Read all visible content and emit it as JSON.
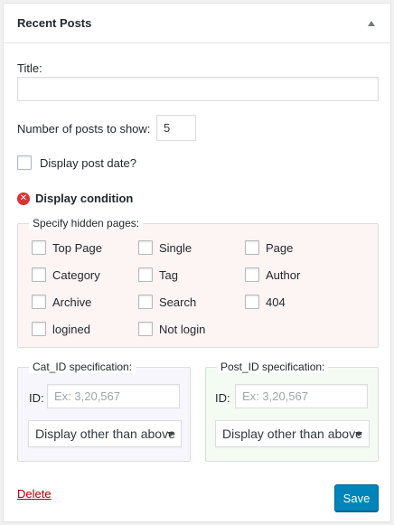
{
  "widget": {
    "title": "Recent Posts",
    "toggle_icon": "triangle-up-icon"
  },
  "form": {
    "title_label": "Title:",
    "title_value": "",
    "number_label": "Number of posts to show:",
    "number_value": "5",
    "display_date_label": "Display post date?"
  },
  "condition": {
    "icon": "error-x-icon",
    "icon_color": "#dc3232",
    "title": "Display condition",
    "hidden_pages": {
      "legend": "Specify hidden pages:",
      "background": "#fdf4f4",
      "items": [
        "Top Page",
        "Single",
        "Page",
        "Category",
        "Tag",
        "Author",
        "Archive",
        "Search",
        "404",
        "logined",
        "Not login"
      ]
    },
    "cat_id": {
      "legend": "Cat_ID specification:",
      "background": "#f6f6fc",
      "id_label": "ID:",
      "placeholder": "Ex: 3,20,567",
      "select_value": "Display other than above"
    },
    "post_id": {
      "legend": "Post_ID specification:",
      "background": "#f3fbf3",
      "id_label": "ID:",
      "placeholder": "Ex: 3,20,567",
      "select_value": "Display other than above"
    }
  },
  "actions": {
    "delete_label": "Delete",
    "save_label": "Save"
  },
  "colors": {
    "accent": "#0085ba",
    "delete": "#a00000"
  }
}
